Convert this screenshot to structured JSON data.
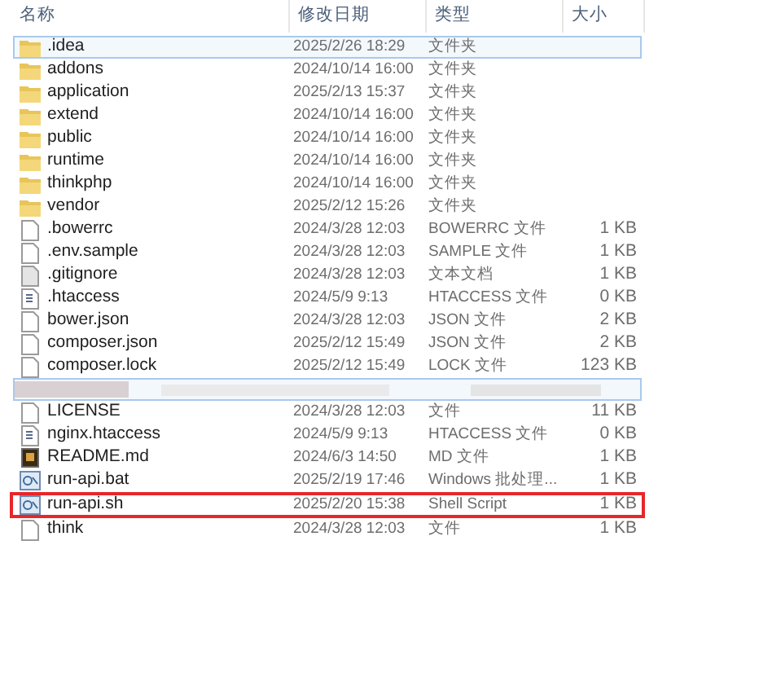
{
  "columns": [
    "名称",
    "修改日期",
    "类型",
    "大小"
  ],
  "rows": [
    {
      "kind": "folder",
      "name": ".idea",
      "date": "2025/2/26 18:29",
      "type": "文件夹",
      "selected": true,
      "highlighted": false
    },
    {
      "kind": "folder",
      "name": "addons",
      "date": "2024/10/14 16:00",
      "type": "文件夹",
      "selected": false,
      "highlighted": false
    },
    {
      "kind": "folder",
      "name": "application",
      "date": "2025/2/13 15:37",
      "type": "文件夹",
      "selected": false,
      "highlighted": false
    },
    {
      "kind": "folder",
      "name": "extend",
      "date": "2024/10/14 16:00",
      "type": "文件夹",
      "selected": false,
      "highlighted": false
    },
    {
      "kind": "folder",
      "name": "public",
      "date": "2024/10/14 16:00",
      "type": "文件夹",
      "selected": false,
      "highlighted": false
    },
    {
      "kind": "folder",
      "name": "runtime",
      "date": "2024/10/14 16:00",
      "type": "文件夹",
      "selected": false,
      "highlighted": false
    },
    {
      "kind": "folder",
      "name": "thinkphp",
      "date": "2024/10/14 16:00",
      "type": "文件夹",
      "selected": false,
      "highlighted": false
    },
    {
      "kind": "folder",
      "name": "vendor",
      "date": "2025/2/12 15:26",
      "type": "文件夹",
      "selected": false,
      "highlighted": false
    },
    {
      "kind": "file",
      "name": ".bowerrc",
      "date": "2024/3/28 12:03",
      "type": "BOWERRC 文件",
      "size": "1 KB",
      "selected": false,
      "highlighted": false
    },
    {
      "kind": "file",
      "name": ".env.sample",
      "date": "2024/3/28 12:03",
      "type": "SAMPLE 文件",
      "size": "1 KB",
      "selected": false,
      "highlighted": false
    },
    {
      "kind": "text",
      "name": ".gitignore",
      "date": "2024/3/28 12:03",
      "type": "文本文档",
      "size": "1 KB",
      "selected": false,
      "highlighted": false
    },
    {
      "kind": "config",
      "name": ".htaccess",
      "date": "2024/5/9 9:13",
      "type": "HTACCESS 文件",
      "size": "0 KB",
      "selected": false,
      "highlighted": false
    },
    {
      "kind": "file",
      "name": "bower.json",
      "date": "2024/3/28 12:03",
      "type": "JSON 文件",
      "size": "2 KB",
      "selected": false,
      "highlighted": false
    },
    {
      "kind": "file",
      "name": "composer.json",
      "date": "2025/2/12 15:49",
      "type": "JSON 文件",
      "size": "2 KB",
      "selected": false,
      "highlighted": false
    },
    {
      "kind": "file",
      "name": "composer.lock",
      "date": "2025/2/12 15:49",
      "type": "LOCK 文件",
      "size": "123 KB",
      "selected": false,
      "highlighted": false
    },
    {
      "kind": "redacted",
      "selected": true
    },
    {
      "kind": "file",
      "name": "LICENSE",
      "date": "2024/3/28 12:03",
      "type": "文件",
      "size": "11 KB",
      "selected": false,
      "highlighted": false
    },
    {
      "kind": "config",
      "name": "nginx.htaccess",
      "date": "2024/5/9 9:13",
      "type": "HTACCESS 文件",
      "size": "0 KB",
      "selected": false,
      "highlighted": false
    },
    {
      "kind": "readme",
      "name": "README.md",
      "date": "2024/6/3 14:50",
      "type": "MD 文件",
      "size": "1 KB",
      "selected": false,
      "highlighted": false
    },
    {
      "kind": "script",
      "name": "run-api.bat",
      "date": "2025/2/19 17:46",
      "type": "Windows 批处理...",
      "size": "1 KB",
      "selected": false,
      "highlighted": false
    },
    {
      "kind": "script",
      "name": "run-api.sh",
      "date": "2025/2/20 15:38",
      "type": "Shell Script",
      "size": "1 KB",
      "selected": false,
      "highlighted": true
    },
    {
      "kind": "file",
      "name": "think",
      "date": "2024/3/28 12:03",
      "type": "文件",
      "size": "1 KB",
      "selected": false,
      "highlighted": false
    }
  ]
}
